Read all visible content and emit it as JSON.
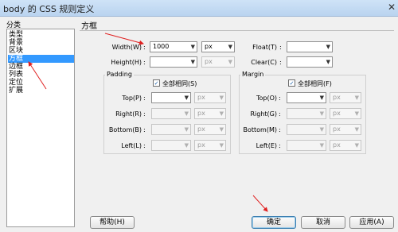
{
  "window": {
    "title": "body 的 CSS 规则定义",
    "close_glyph": "✕"
  },
  "categories": {
    "header": "分类",
    "items": [
      "类型",
      "背景",
      "区块",
      "方框",
      "边框",
      "列表",
      "定位",
      "扩展"
    ],
    "selected_index": 3
  },
  "panel": {
    "title": "方框"
  },
  "box": {
    "width_label": "Width(W)",
    "width_value": "1000",
    "width_unit": "px",
    "height_label": "Height(H)",
    "height_value": "",
    "height_unit": "px",
    "float_label": "Float(T)",
    "float_value": "",
    "clear_label": "Clear(C)",
    "clear_value": ""
  },
  "padding": {
    "title": "Padding",
    "same_label": "全部相同(S)",
    "same_checked": true,
    "rows": [
      {
        "label": "Top(P)",
        "value": "",
        "unit": "px"
      },
      {
        "label": "Right(R)",
        "value": "",
        "unit": "px"
      },
      {
        "label": "Bottom(B)",
        "value": "",
        "unit": "px"
      },
      {
        "label": "Left(L)",
        "value": "",
        "unit": "px"
      }
    ]
  },
  "margin": {
    "title": "Margin",
    "same_label": "全部相同(F)",
    "same_checked": true,
    "rows": [
      {
        "label": "Top(O)",
        "value": "",
        "unit": "px"
      },
      {
        "label": "Right(G)",
        "value": "",
        "unit": "px"
      },
      {
        "label": "Bottom(M)",
        "value": "",
        "unit": "px"
      },
      {
        "label": "Left(E)",
        "value": "",
        "unit": "px"
      }
    ]
  },
  "buttons": {
    "help": "帮助(H)",
    "ok": "确定",
    "cancel": "取消",
    "apply": "应用(A)"
  },
  "colors": {
    "selection": "#3399ff",
    "annotation_arrow": "#e02020"
  },
  "icons": {
    "dropdown": "▼",
    "check": "✓"
  }
}
